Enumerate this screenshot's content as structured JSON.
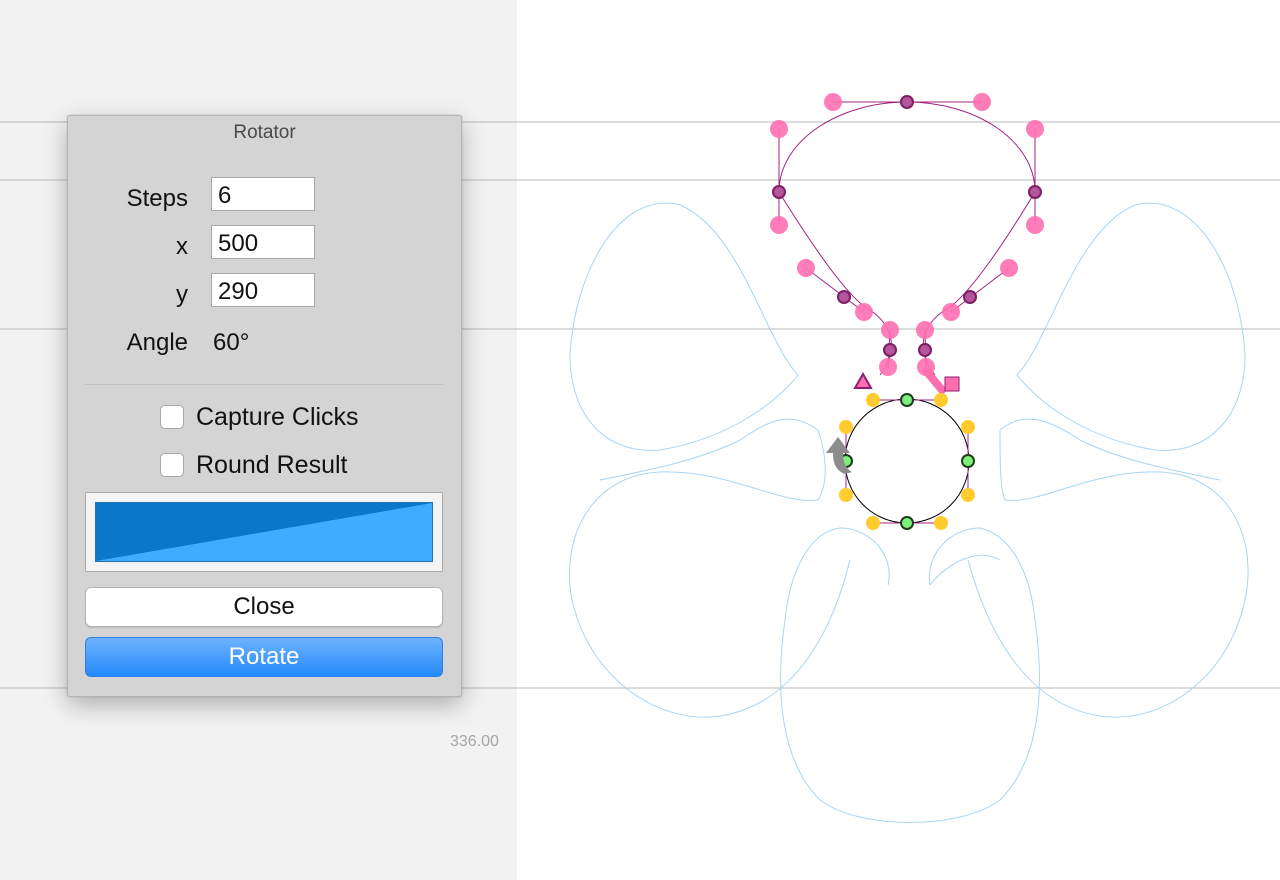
{
  "panel": {
    "title": "Rotator",
    "fields": {
      "steps": {
        "label": "Steps",
        "value": "6"
      },
      "x": {
        "label": "x",
        "value": "500"
      },
      "y": {
        "label": "y",
        "value": "290"
      }
    },
    "angle": {
      "label": "Angle",
      "value": "60°"
    },
    "checkboxes": {
      "capture_clicks": {
        "label": "Capture Clicks",
        "checked": false
      },
      "round_result": {
        "label": "Round Result",
        "checked": false
      }
    },
    "color_well": {
      "color_dark": "#0a78c9",
      "color_light": "#3eacff"
    },
    "buttons": {
      "close": "Close",
      "rotate": "Rotate"
    }
  },
  "canvas": {
    "coordinate_readout": "336.00",
    "colors": {
      "glyph_outline": "#a0247e",
      "off_curve_point": "#ff6fb0",
      "on_curve_point": "#b5559c",
      "ghost_outline": "#a9d5f3",
      "selection_off_point": "#ffcb2e",
      "selection_on_point": "#7ef07a",
      "metric_line": "#b8b8b8"
    },
    "icons": [
      "start-point-triangle-icon",
      "end-point-square-icon",
      "direction-arrow-icon"
    ]
  }
}
